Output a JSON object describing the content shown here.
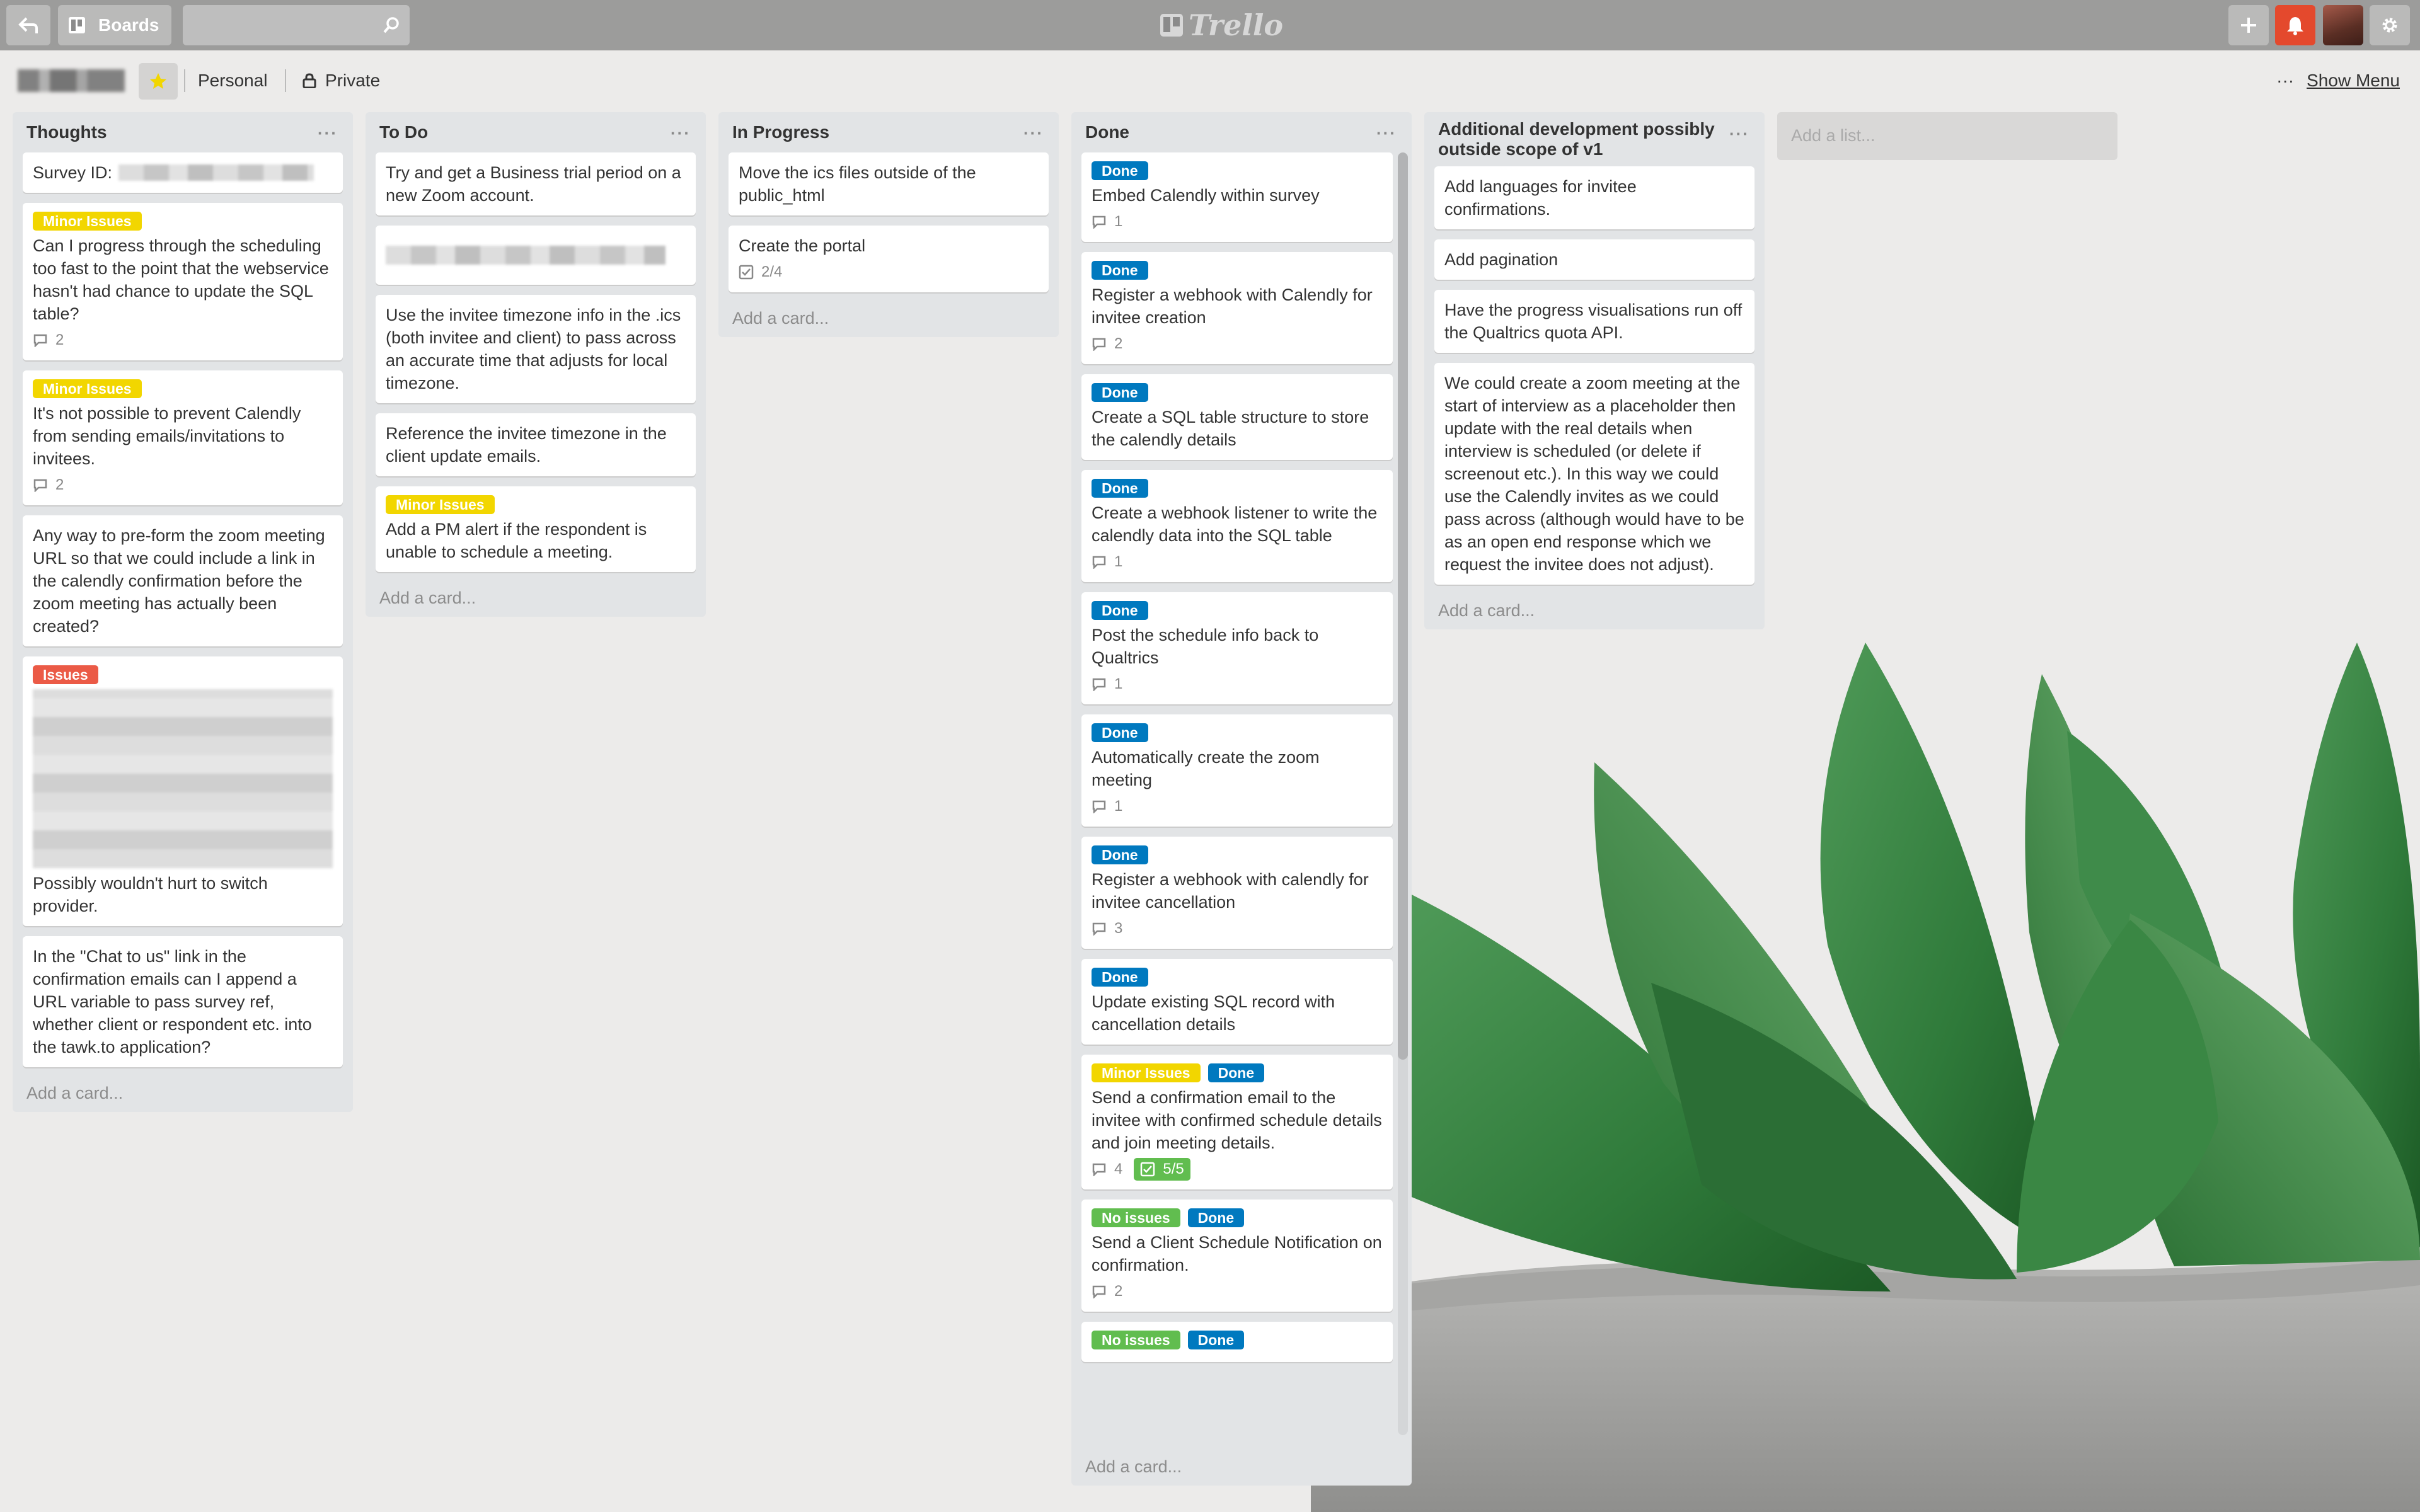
{
  "header": {
    "boards_label": "Boards",
    "logo_text": "Trello"
  },
  "board": {
    "personal_label": "Personal",
    "privacy_label": "Private",
    "show_menu_label": "Show Menu",
    "ellipsis": "···"
  },
  "colors": {
    "minor_issues": "#f2d600",
    "issues": "#eb5a46",
    "done": "#0079bf",
    "no_issues": "#61bd4f"
  },
  "lists": {
    "thoughts": {
      "title": "Thoughts",
      "add_card": "Add a card...",
      "cards": [
        {
          "text": "Survey ID:"
        },
        {
          "label": "Minor Issues",
          "text": "Can I progress through the scheduling too fast to the point that the webservice hasn't had chance to update the SQL table?",
          "comments": "2"
        },
        {
          "label": "Minor Issues",
          "text": "It's not possible to prevent Calendly from sending emails/invitations to invitees.",
          "comments": "2"
        },
        {
          "text": "Any way to pre-form the zoom meeting URL so that we could include a link in the calendly confirmation before the zoom meeting has actually been created?"
        },
        {
          "label": "Issues",
          "text": "Possibly wouldn't hurt to switch provider."
        },
        {
          "text": "In the \"Chat to us\" link in the confirmation emails can I append a URL variable to pass survey ref, whether client or respondent etc. into the tawk.to application?"
        }
      ]
    },
    "todo": {
      "title": "To Do",
      "add_card": "Add a card...",
      "cards": [
        {
          "text": "Try and get a Business trial period on a new Zoom account."
        },
        {
          "text": "Use the invitee timezone info in the .ics (both invitee and client) to pass across an accurate time that adjusts for local timezone."
        },
        {
          "text": "Reference the invitee timezone in the client update emails."
        },
        {
          "label": "Minor Issues",
          "text": "Add a PM alert if the respondent is unable to schedule a meeting."
        }
      ]
    },
    "inprogress": {
      "title": "In Progress",
      "add_card": "Add a card...",
      "cards": [
        {
          "text": "Move the ics files outside of the public_html"
        },
        {
          "text": "Create the portal",
          "checklist": "2/4"
        }
      ]
    },
    "done": {
      "title": "Done",
      "add_card": "Add a card...",
      "cards": [
        {
          "labels": [
            "Done"
          ],
          "text": "Embed Calendly within survey",
          "comments": "1"
        },
        {
          "labels": [
            "Done"
          ],
          "text": "Register a webhook with Calendly for invitee creation",
          "comments": "2"
        },
        {
          "labels": [
            "Done"
          ],
          "text": "Create a SQL table structure to store the calendly details"
        },
        {
          "labels": [
            "Done"
          ],
          "text": "Create a webhook listener to write the calendly data into the SQL table",
          "comments": "1"
        },
        {
          "labels": [
            "Done"
          ],
          "text": "Post the schedule info back to Qualtrics",
          "comments": "1"
        },
        {
          "labels": [
            "Done"
          ],
          "text": "Automatically create the zoom meeting",
          "comments": "1"
        },
        {
          "labels": [
            "Done"
          ],
          "text": "Register a webhook with calendly for invitee cancellation",
          "comments": "3"
        },
        {
          "labels": [
            "Done"
          ],
          "text": "Update existing SQL record with cancellation details"
        },
        {
          "labels": [
            "Minor Issues",
            "Done"
          ],
          "text": "Send a confirmation email to the invitee with confirmed schedule details and join meeting details.",
          "comments": "4",
          "checklist": "5/5"
        },
        {
          "labels": [
            "No issues",
            "Done"
          ],
          "text": "Send a Client Schedule Notification on confirmation.",
          "comments": "2"
        },
        {
          "labels": [
            "No issues",
            "Done"
          ]
        }
      ]
    },
    "additional": {
      "title": "Additional development possibly outside scope of v1",
      "add_card": "Add a card...",
      "cards": [
        {
          "text": "Add languages for invitee confirmations."
        },
        {
          "text": "Add pagination"
        },
        {
          "text": "Have the progress visualisations run off the Qualtrics quota API."
        },
        {
          "text": "We could create a zoom meeting at the start of interview as a placeholder then update with the real details when interview is scheduled (or delete if screenout etc.). In this way we could use the Calendly invites as we could pass across (although would have to be as an open end response which we request the invitee does not adjust)."
        }
      ]
    }
  },
  "add_list_placeholder": "Add a list..."
}
